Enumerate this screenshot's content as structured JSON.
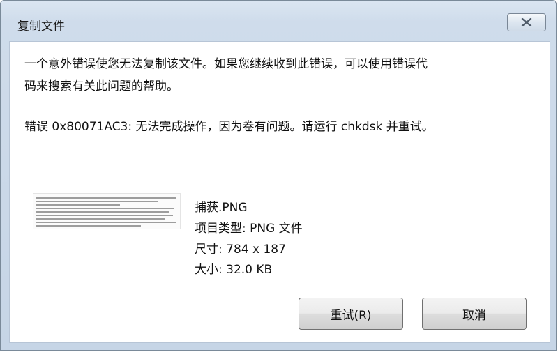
{
  "window": {
    "title": "复制文件",
    "close_icon": "close-icon"
  },
  "message": {
    "line1": "一个意外错误使您无法复制该文件。如果您继续收到此错误，可以使用错误代",
    "line2": "码来搜索有关此问题的帮助。",
    "error": "错误 0x80071AC3: 无法完成操作，因为卷有问题。请运行 chkdsk 并重试。"
  },
  "file": {
    "name": "捕获.PNG",
    "type": "项目类型: PNG 文件",
    "dimensions": "尺寸: 784 x 187",
    "size": "大小: 32.0 KB"
  },
  "buttons": {
    "retry": "重试(R)",
    "cancel": "取消"
  }
}
